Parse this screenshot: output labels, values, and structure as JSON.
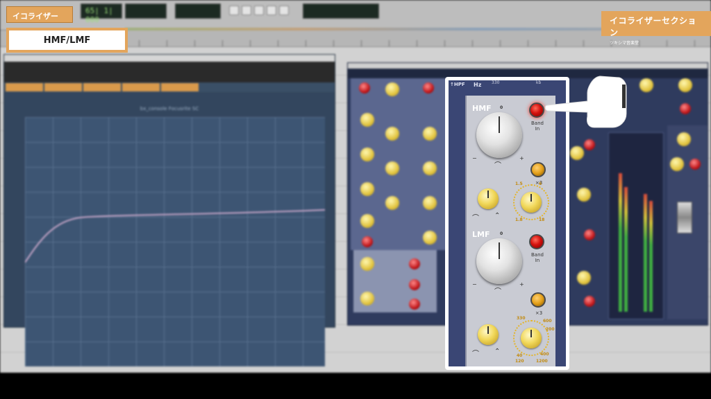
{
  "overlay": {
    "corner_label": "イコライザー",
    "section_label": "イコライザーセクション",
    "section_sub": "ツキシマ音楽堂",
    "name_box": "HMF/LMF"
  },
  "background": {
    "counter_main": "65| 1| 000",
    "eq_window_title": "bx_console Focusrite SC"
  },
  "zoom_panel": {
    "top_hpf": "↑HPF",
    "top_hz": "Hz",
    "top_330": "330",
    "top_kb": "kb",
    "hmf": {
      "title": "HMF",
      "band_in_label": "Band\nIn",
      "x3_label": "×3",
      "gain_zero": "0",
      "minus": "−",
      "plus": "+",
      "freq_ticks": [
        "1.5",
        "6",
        "1.8",
        "18"
      ],
      "band_in_active": true
    },
    "lmf": {
      "title": "LMF",
      "band_in_label": "Band\nIn",
      "x3_label": "×3",
      "gain_zero": "0",
      "minus": "−",
      "plus": "+",
      "freq_ticks": [
        "330",
        "600",
        "200",
        "40",
        "120",
        "1200",
        "400"
      ],
      "band_in_active": false
    }
  },
  "colors": {
    "accent_orange": "#e3a55c",
    "panel_blue": "#3a4674",
    "knob_yellow": "#f1d85a",
    "button_red": "#d4120e"
  }
}
